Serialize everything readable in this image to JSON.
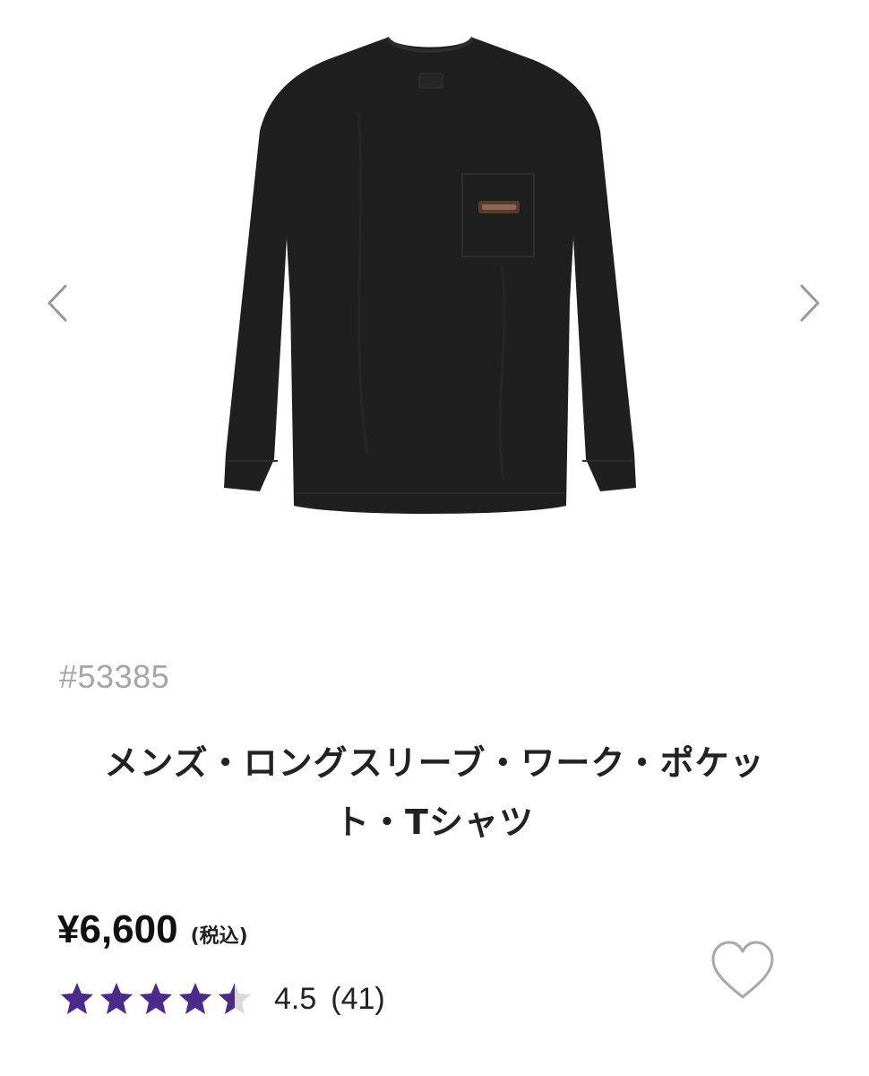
{
  "gallery": {
    "prev_icon": "chevron-left-icon",
    "next_icon": "chevron-right-icon"
  },
  "product": {
    "number": "#53385",
    "name_line1": "メンズ・ロングスリーブ・ワーク・ポケッ",
    "name_line2": "ト・Tシャツ",
    "price": "¥6,600",
    "tax_note": "(税込)",
    "rating": {
      "value_text": "4.5",
      "count_text": "(41)",
      "value": 4.5,
      "max": 5
    },
    "wishlist_icon": "heart-outline-icon"
  },
  "colors": {
    "star": "#4b2a8c",
    "star_empty": "#d9d9d9",
    "garment": "#1f1f1f",
    "product_number": "#a6a6a6",
    "arrow": "#999999"
  }
}
